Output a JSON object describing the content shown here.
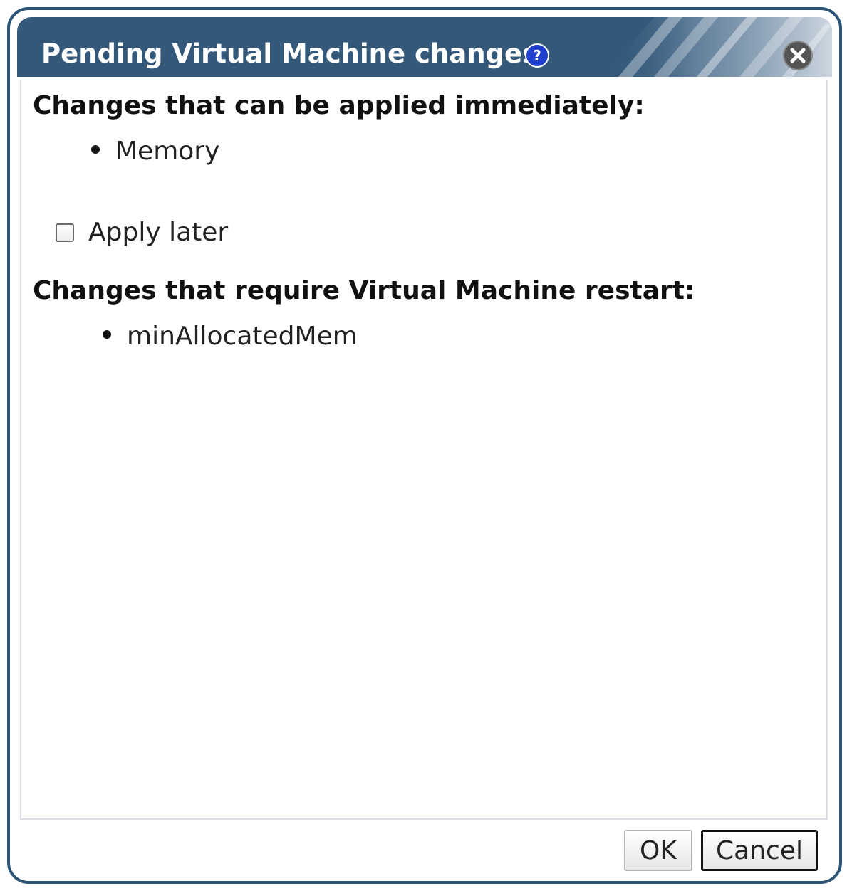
{
  "dialog": {
    "title": "Pending Virtual Machine changes",
    "help_icon": "question-help-icon",
    "close_icon": "close-circle-icon"
  },
  "sections": {
    "immediate": {
      "heading": "Changes that can be applied immediately:",
      "items": [
        "Memory"
      ]
    },
    "apply_later": {
      "label": "Apply later",
      "checked": false
    },
    "restart": {
      "heading": "Changes that require Virtual Machine restart:",
      "items": [
        "minAllocatedMem"
      ]
    }
  },
  "buttons": {
    "ok": "OK",
    "cancel": "Cancel"
  },
  "colors": {
    "title_bar": "#33587a",
    "border": "#2b5477",
    "help_icon": "#1f3fcf"
  }
}
